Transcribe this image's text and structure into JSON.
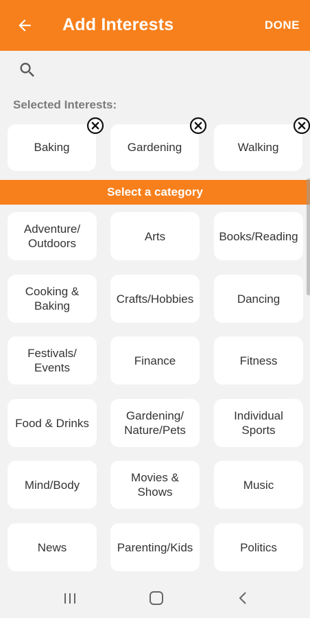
{
  "header": {
    "title": "Add Interests",
    "done_label": "DONE",
    "background": "#f7801d"
  },
  "search": {
    "icon": "search-icon"
  },
  "selected": {
    "label": "Selected Interests:",
    "items": [
      "Baking",
      "Gardening",
      "Walking"
    ]
  },
  "category_bar": {
    "label": "Select a category"
  },
  "categories": [
    "Adventure/\nOutdoors",
    "Arts",
    "Books/Reading",
    "Cooking &\nBaking",
    "Crafts/Hobbies",
    "Dancing",
    "Festivals/\nEvents",
    "Finance",
    "Fitness",
    "Food & Drinks",
    "Gardening/\nNature/Pets",
    "Individual\nSports",
    "Mind/Body",
    "Movies &\nShows",
    "Music",
    "News",
    "Parenting/Kids",
    "Politics"
  ],
  "navbar": {
    "icons": [
      "recent-apps-icon",
      "home-icon",
      "back-nav-icon"
    ]
  }
}
